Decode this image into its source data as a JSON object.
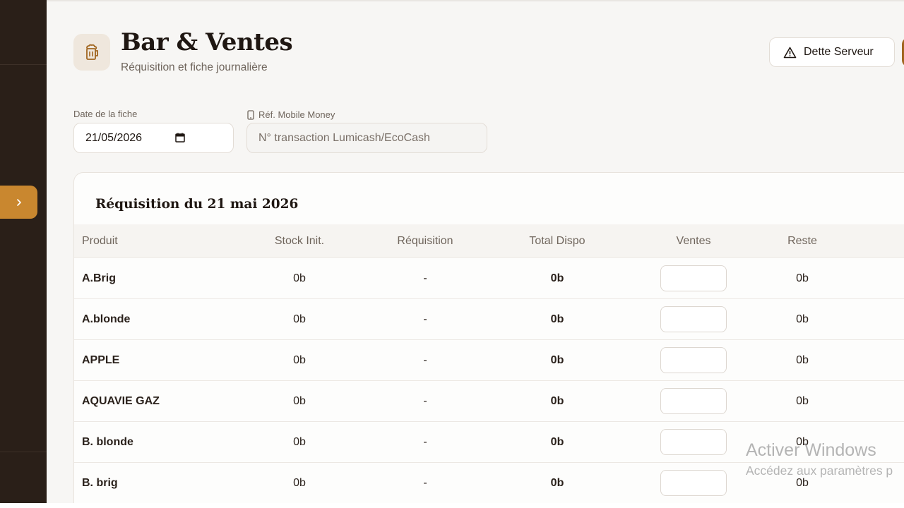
{
  "header": {
    "title": "Bar & Ventes",
    "subtitle": "Réquisition et fiche journalière",
    "icon": "beer-mug-icon",
    "dette_button": "Dette Serveur",
    "dette_icon": "warning-triangle-icon"
  },
  "filters": {
    "date_label": "Date de la fiche",
    "date_value": "21/05/2026",
    "mobile_money_label": "Réf. Mobile Money",
    "mobile_money_placeholder": "N° transaction Lumicash/EcoCash"
  },
  "sidebar": {
    "toggle_icon": "chevron-right-icon",
    "accent_color": "#c9872f"
  },
  "requisition": {
    "title": "Réquisition du 21 mai 2026",
    "columns": [
      "Produit",
      "Stock Init.",
      "Réquisition",
      "Total Dispo",
      "Ventes",
      "Reste"
    ],
    "rows": [
      {
        "produit": "A.Brig",
        "stock": "0b",
        "requisition": "-",
        "total": "0b",
        "reste": "0b"
      },
      {
        "produit": "A.blonde",
        "stock": "0b",
        "requisition": "-",
        "total": "0b",
        "reste": "0b"
      },
      {
        "produit": "APPLE",
        "stock": "0b",
        "requisition": "-",
        "total": "0b",
        "reste": "0b"
      },
      {
        "produit": "AQUAVIE GAZ",
        "stock": "0b",
        "requisition": "-",
        "total": "0b",
        "reste": "0b"
      },
      {
        "produit": "B. blonde",
        "stock": "0b",
        "requisition": "-",
        "total": "0b",
        "reste": "0b"
      },
      {
        "produit": "B. brig",
        "stock": "0b",
        "requisition": "-",
        "total": "0b",
        "reste": "0b"
      }
    ]
  },
  "watermark": {
    "line1": "Activer Windows",
    "line2": "Accédez aux paramètres p"
  }
}
